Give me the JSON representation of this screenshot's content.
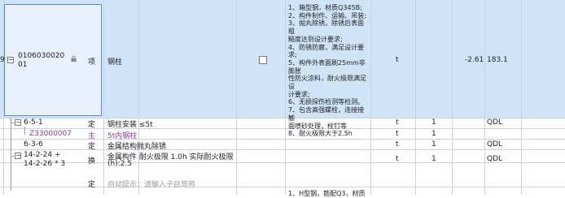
{
  "main_row": {
    "left_marker": "9",
    "code_line1": "0106030020",
    "code_line2": "01",
    "type": "项",
    "name": "钢柱",
    "description": [
      "1、箱型钢，材质Q345B;",
      "2、构件制作、运输、吊装;",
      "3、抛丸除锈，除锈后表面粗",
      "糙度达到设计要求;",
      "4、防锈防腐，满足设计要",
      "求;",
      "5、构件外表面刷25mm非膨胀",
      "性防火涂料，耐火极限满足设",
      "计要求;",
      "6、无损探伤检测等检测。",
      "7、包含高强螺栓，连接接触",
      "面喷砂处理，栓钉等",
      "8、耐火极限大于2.5h"
    ],
    "unit": "t",
    "quantity_expr": "-2.61",
    "quantity": "183.1"
  },
  "rows": [
    {
      "code": "6-5-1",
      "type": "定",
      "name": "钢柱安装 ≤5t",
      "unit": "t",
      "qty": "1",
      "expr": "QDL"
    },
    {
      "code": "Z33000007",
      "type": "主",
      "name": "5t内钢柱",
      "unit": "t",
      "qty": "1",
      "expr": ""
    },
    {
      "code": "6-3-6",
      "type": "定",
      "name": "金属结构抛丸除锈",
      "unit": "t",
      "qty": "1",
      "expr": "QDL"
    },
    {
      "code_line1": "14-2-24 +",
      "code_line2": "14-2-26 * 3",
      "type": "换",
      "name_line1": "金属构件  耐火极限 1.0h  实际耐火极限",
      "name_line2": "(h):2.5",
      "unit": "t",
      "qty": "1",
      "expr": "QDL"
    },
    {
      "code": "",
      "type": "定",
      "name": "自动提示：请输入子目简称",
      "unit": "",
      "qty": "",
      "expr": ""
    }
  ],
  "bottom_partial": "1、H型钢，筋配Q3，材质"
}
